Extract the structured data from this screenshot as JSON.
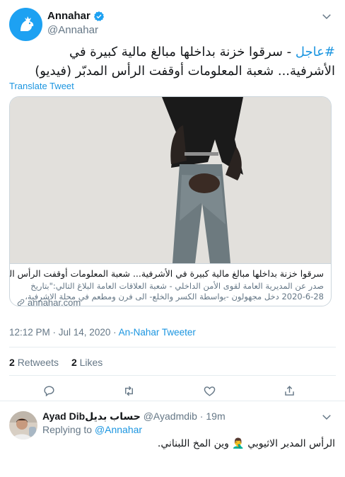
{
  "tweet": {
    "display_name": "Annahar",
    "handle": "@Annahar",
    "hashtag": "#عاجل",
    "text": "- سرقوا خزنة بداخلها مبالغ مالية كبيرة في الأشرفية... شعبة المعلومات أوقفت الرأس المدبّر (فيديو)",
    "translate_label": "Translate Tweet",
    "card": {
      "title": "سرقوا خزنة بداخلها مبالغ مالية كبيرة في الأشرفية... شعبة المعلومات أوقفت الرأس المدبّر (فيديو)",
      "description": "صدر عن المديرية العامة لقوى الأمن الداخلي - شعبة العلاقات العامة البلاغ التالي:\"بتاريخ 28-6-2020 دخل مجهولون -بواسطة الكسر والخلع- الى فرن ومطعم في محلة الاشرفية، وسرقوا من داخل خزنة",
      "domain": "annahar.com"
    },
    "time": "12:12 PM · Jul 14, 2020",
    "separator": " · ",
    "source": "An-Nahar Tweeter",
    "retweets_count": "2",
    "retweets_label": "Retweets",
    "likes_count": "2",
    "likes_label": "Likes"
  },
  "reply": {
    "display_name": "Ayad Dibحساب بديل",
    "handle": "@Ayadmdib",
    "time": "19m",
    "separator": " · ",
    "replying_prefix": "Replying to",
    "replying_to": "@Annahar",
    "text": "الرأس المدبر الاثيوبي 🤦‍♂️ وين المخ اللبناني."
  },
  "icons": {
    "reply": "reply-icon",
    "retweet": "retweet-icon",
    "like": "heart-icon",
    "share": "share-icon",
    "verified": "verified-badge-icon",
    "caret": "chevron-down-icon",
    "link": "link-icon"
  },
  "colors": {
    "accent": "#1b95e0",
    "secondary_text": "#657786",
    "border": "#ccd6dd"
  }
}
